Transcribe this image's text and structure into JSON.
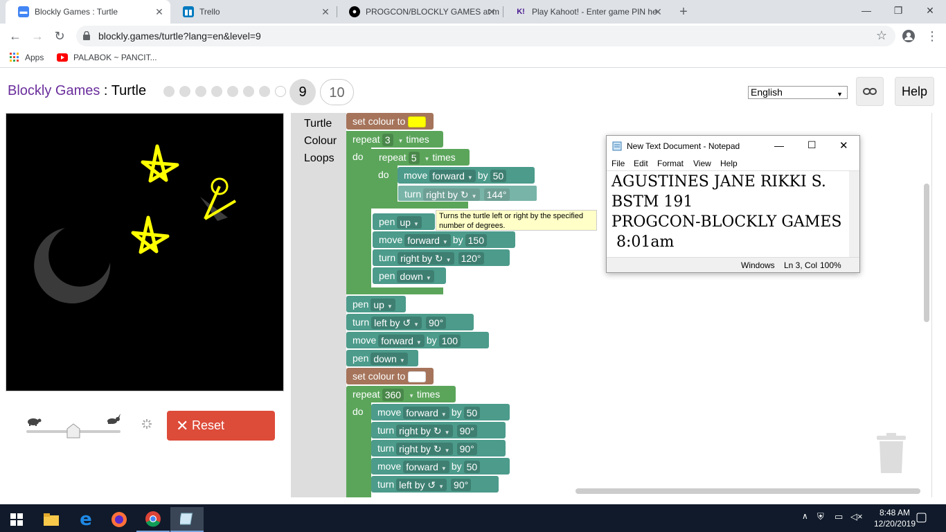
{
  "browser": {
    "tabs": [
      {
        "title": "Blockly Games : Turtle",
        "active": true
      },
      {
        "title": "Trello",
        "active": false
      },
      {
        "title": "PROGCON/BLOCKLY GAMES at m",
        "active": false
      },
      {
        "title": "Play Kahoot! - Enter game PIN he",
        "active": false
      }
    ],
    "url": "blockly.games/turtle?lang=en&level=9",
    "bookmarks": [
      "Apps",
      "PALABOK ~ PANCIT..."
    ]
  },
  "header": {
    "brand": "Blockly Games",
    "sep": " : ",
    "page": "Turtle",
    "current_level": "9",
    "next_level": "10",
    "language": "English",
    "help_label": "Help"
  },
  "controls": {
    "reset_label": "Reset"
  },
  "toolbox": [
    "Turtle",
    "Colour",
    "Loops"
  ],
  "blocks": {
    "set_colour": "set colour to",
    "repeat": "repeat",
    "times": "times",
    "do": "do",
    "move": "move",
    "turn": "turn",
    "pen": "pen",
    "by": "by",
    "forward": "forward",
    "right_by": "right by ↻",
    "left_by": "left by ↺",
    "up": "up",
    "down": "down",
    "n3": "3",
    "n5": "5",
    "n50": "50",
    "n144": "144°",
    "n150": "150",
    "n120": "120°",
    "n90": "90°",
    "n100": "100",
    "n360": "360"
  },
  "tooltip": "Turns the turtle left or right by the specified number of degrees.",
  "notepad": {
    "title": "New Text Document - Notepad",
    "menu": [
      "File",
      "Edit",
      "Format",
      "View",
      "Help"
    ],
    "lines": [
      "AGUSTINES JANE RIKKI S.",
      "BSTM 191",
      "PROGCON-BLOCKLY GAMES",
      " 8:01am"
    ],
    "status": [
      "Windows",
      "Ln 3, Col",
      "100%"
    ]
  },
  "taskbar": {
    "time": "8:48 AM",
    "date": "12/20/2019"
  },
  "colors": {
    "brand": "#6a2e9c",
    "loop": "#5ba55b",
    "turtle": "#4c9b8b",
    "colour": "#a5745b",
    "reset": "#dd4b39",
    "star": "#ffff00"
  }
}
